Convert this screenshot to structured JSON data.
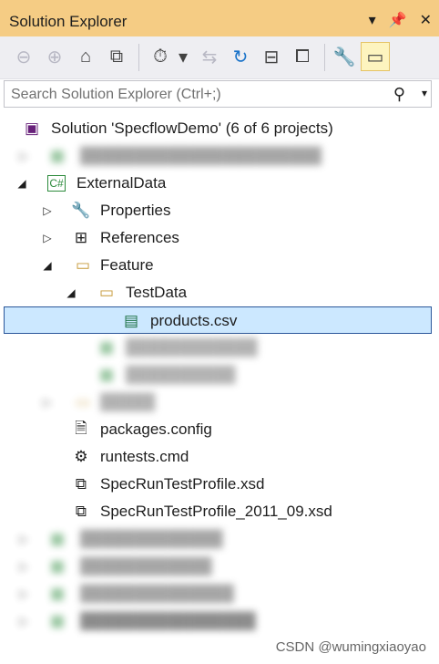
{
  "window": {
    "title": "Solution Explorer"
  },
  "search": {
    "placeholder": "Search Solution Explorer (Ctrl+;)"
  },
  "tree": {
    "solution": "Solution 'SpecflowDemo' (6 of 6 projects)",
    "external_data": "ExternalData",
    "properties": "Properties",
    "references": "References",
    "feature": "Feature",
    "testdata": "TestData",
    "products_csv": "products.csv",
    "packages_config": "packages.config",
    "runtests_cmd": "runtests.cmd",
    "spec_profile": "SpecRunTestProfile.xsd",
    "spec_profile_2011": "SpecRunTestProfile_2011_09.xsd"
  },
  "watermark": "CSDN @wumingxiaoyao"
}
